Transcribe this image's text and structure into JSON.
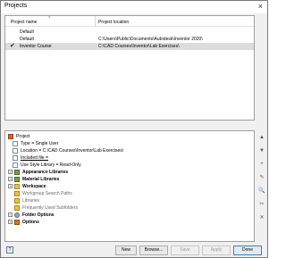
{
  "window": {
    "title": "Projects",
    "close_glyph": "×"
  },
  "projects_table": {
    "col_name": "Project name",
    "col_location": "Project location",
    "sort_glyph": "^",
    "rows": [
      {
        "name": "Default",
        "location": "",
        "active": false,
        "selected": false
      },
      {
        "name": "Default",
        "location": "C:\\Users\\Public\\Documents\\Autodesk\\Inventor 2020\\",
        "active": false,
        "selected": false
      },
      {
        "name": "Inventor Course",
        "location": "C:\\CAD Courses\\Inventor\\Lab Exercises\\",
        "active": true,
        "selected": true
      }
    ]
  },
  "check_glyph": "✔",
  "tree": {
    "project": "Project",
    "type": "Type = Single User",
    "location": "Location = C:\\CAD Courses\\Inventor\\Lab Exercises\\",
    "included_file": "Included file =",
    "use_style_library": "Use Style Library = Read-Only",
    "appearance_libraries": "Appearance Libraries",
    "material_libraries": "Material Libraries",
    "workspace": "Workspace",
    "workgroup_search_paths": "Workgroup Search Paths",
    "libraries": "Libraries",
    "frequently_used_subfolders": "Frequently Used Subfolders",
    "folder_options": "Folder Options",
    "options": "Options",
    "expand_glyph": "+"
  },
  "side_buttons": [
    "▲",
    "▼",
    "+",
    "✎",
    "🔍",
    "✂",
    "✕"
  ],
  "buttons": {
    "new": "New",
    "browse": "Browse...",
    "save": "Save",
    "apply": "Apply",
    "done": "Done",
    "help": "?"
  },
  "colors": {
    "selected_row": "#dcdcdc",
    "dialog_bg": "#f0f0f0",
    "primary_border": "#3b7fd0"
  }
}
